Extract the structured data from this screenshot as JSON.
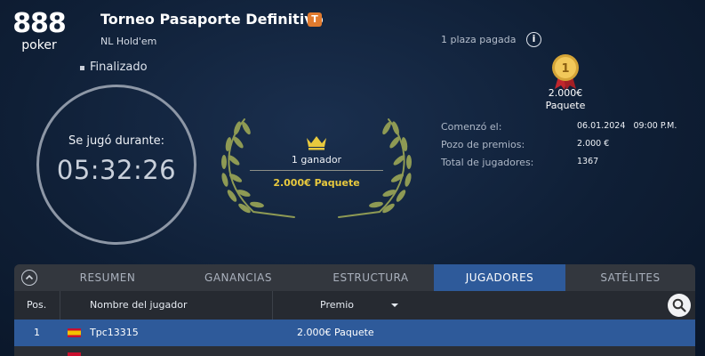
{
  "brand": {
    "logo_number": "888",
    "logo_word": "poker"
  },
  "tournament": {
    "title": "Torneo Pasaporte Definitivo",
    "badge": "T",
    "game": "NL Hold'em",
    "status": "Finalizado",
    "paid_places": "1 plaza pagada"
  },
  "timer": {
    "label": "Se jugó durante:",
    "value": "05:32:26"
  },
  "winner": {
    "count_text": "1 ganador",
    "prize": "2.000€ Paquete"
  },
  "medal": {
    "rank": "1",
    "prize": "2.000€",
    "package": "Paquete"
  },
  "info": [
    {
      "label": "Comenzó el:",
      "value": "06.01.2024   09:00 P.M."
    },
    {
      "label": "Pozo de premios:",
      "value": "2.000 €"
    },
    {
      "label": "Total de jugadores:",
      "value": "1367"
    }
  ],
  "tabs": [
    {
      "label": "RESUMEN",
      "active": false
    },
    {
      "label": "GANANCIAS",
      "active": false
    },
    {
      "label": "ESTRUCTURA",
      "active": false
    },
    {
      "label": "JUGADORES",
      "active": true
    },
    {
      "label": "SATÉLITES",
      "active": false
    }
  ],
  "table": {
    "headers": {
      "pos": "Pos.",
      "name": "Nombre del jugador",
      "prize": "Premio"
    },
    "rows": [
      {
        "pos": "1",
        "name": "Tpc13315",
        "prize": "2.000€ Paquete",
        "flag": "spain-flag"
      }
    ]
  },
  "colors": {
    "accent": "#2e5a9a",
    "gold": "#e8c93e",
    "badge": "#e07a2e"
  }
}
